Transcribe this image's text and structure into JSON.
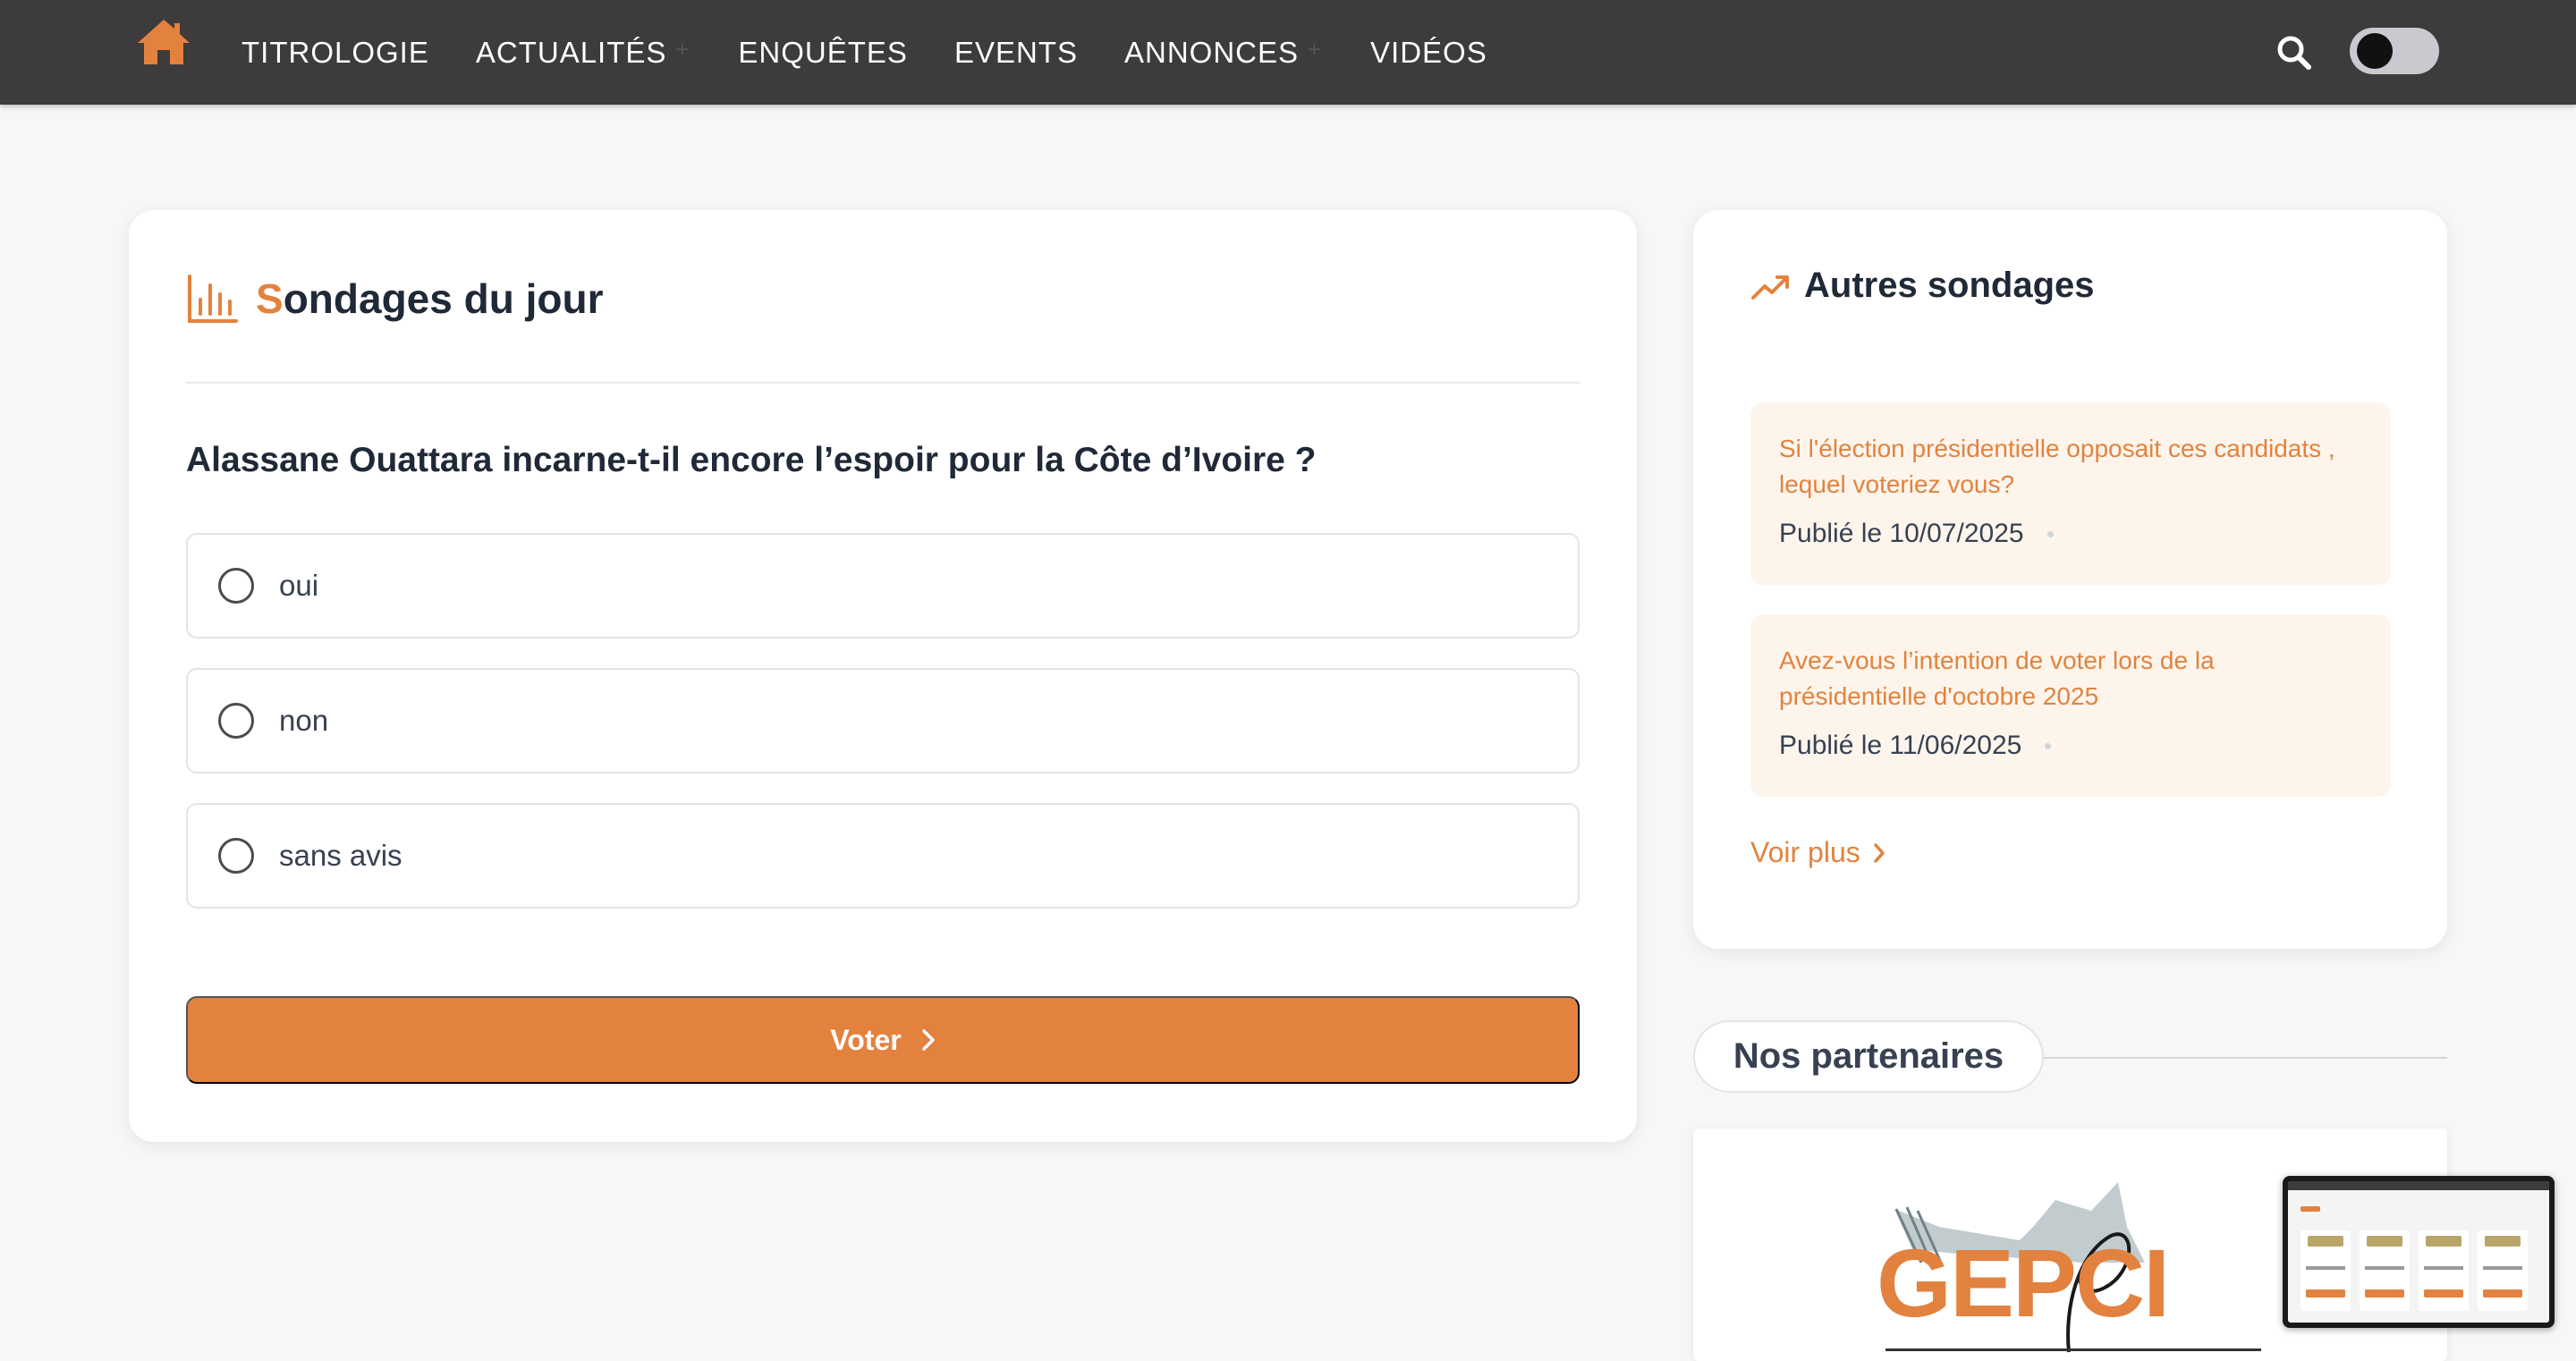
{
  "nav": {
    "items": [
      {
        "label": "TITROLOGIE"
      },
      {
        "label": "ACTUALITÉS"
      },
      {
        "label": "ENQUÊTES"
      },
      {
        "label": "EVENTS"
      },
      {
        "label": "ANNONCES"
      },
      {
        "label": "VIDÉOS"
      }
    ],
    "submenu_marker": "+",
    "home_icon": "home-icon",
    "search_icon": "search-icon",
    "theme_toggle_state": "off"
  },
  "poll": {
    "title_first_letter": "S",
    "title_rest": "ondages du jour",
    "question": "Alassane Ouattara incarne-t-il encore l’espoir pour la Côte d’Ivoire ?",
    "options": [
      {
        "label": "oui"
      },
      {
        "label": "non"
      },
      {
        "label": "sans avis"
      }
    ],
    "vote_label": "Voter"
  },
  "others": {
    "title": "Autres sondages",
    "items": [
      {
        "title": "Si l'élection présidentielle opposait ces candidats , lequel voteriez vous?",
        "date": "Publié le 10/07/2025"
      },
      {
        "title": "Avez-vous l’intention de voter lors de la présidentielle d'octobre 2025",
        "date": "Publié le 11/06/2025"
      }
    ],
    "see_more": "Voir plus"
  },
  "partners": {
    "title": "Nos partenaires",
    "logo_text": "GEPCI"
  },
  "colors": {
    "accent": "#e3823e",
    "navbar": "#3d3b3c",
    "item_bg": "#fdf5ec"
  }
}
